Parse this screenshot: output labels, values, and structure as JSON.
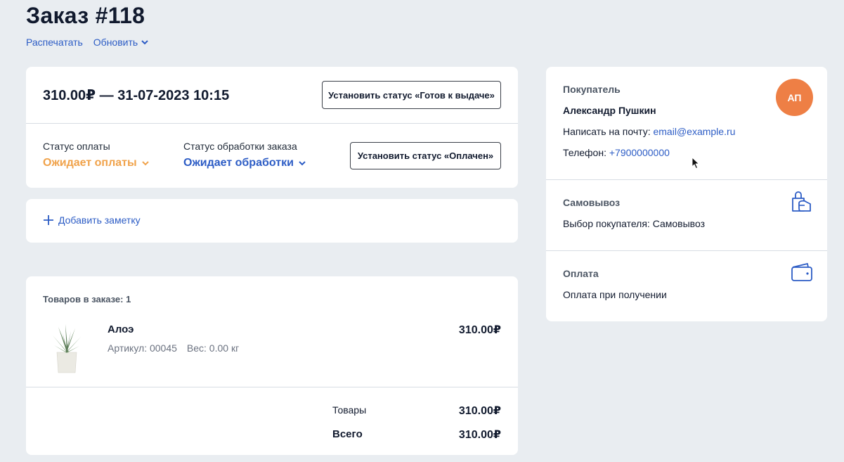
{
  "header": {
    "title": "Заказ  #118",
    "print_label": "Распечатать",
    "refresh_label": "Обновить"
  },
  "order": {
    "summary": "310.00₽ — 31-07-2023 10:15",
    "ready_button": "Установить статус «Готов к выдаче»",
    "paid_button": "Установить статус «Оплачен»",
    "payment_status_label": "Статус оплаты",
    "payment_status_value": "Ожидает оплаты",
    "processing_status_label": "Статус обработки заказа",
    "processing_status_value": "Ожидает обработки"
  },
  "note": {
    "add_label": "Добавить заметку"
  },
  "items": {
    "count_label": "Товаров в заказе: 1",
    "list": [
      {
        "name": "Алоэ",
        "sku": "Артикул: 00045",
        "weight": "Вес: 0.00 кг",
        "price": "310.00₽"
      }
    ],
    "totals": {
      "goods_label": "Товары",
      "goods_value": "310.00₽",
      "total_label": "Всего",
      "total_value": "310.00₽"
    }
  },
  "customer": {
    "heading": "Покупатель",
    "name": "Александр Пушкин",
    "email_prefix": "Написать на почту: ",
    "email": "email@example.ru",
    "phone_prefix": "Телефон: ",
    "phone": "+7900000000",
    "avatar_initials": "АП"
  },
  "delivery": {
    "heading": "Самовывоз",
    "text": "Выбор покупателя: Самовывоз",
    "icon": "shopping-bag-icon"
  },
  "payment": {
    "heading": "Оплата",
    "text": "Оплата при получении",
    "icon": "wallet-icon"
  },
  "colors": {
    "accent": "#2c5cc5",
    "pending_payment": "#f0a24a",
    "avatar": "#ee7f45",
    "background": "#e9edf1"
  }
}
